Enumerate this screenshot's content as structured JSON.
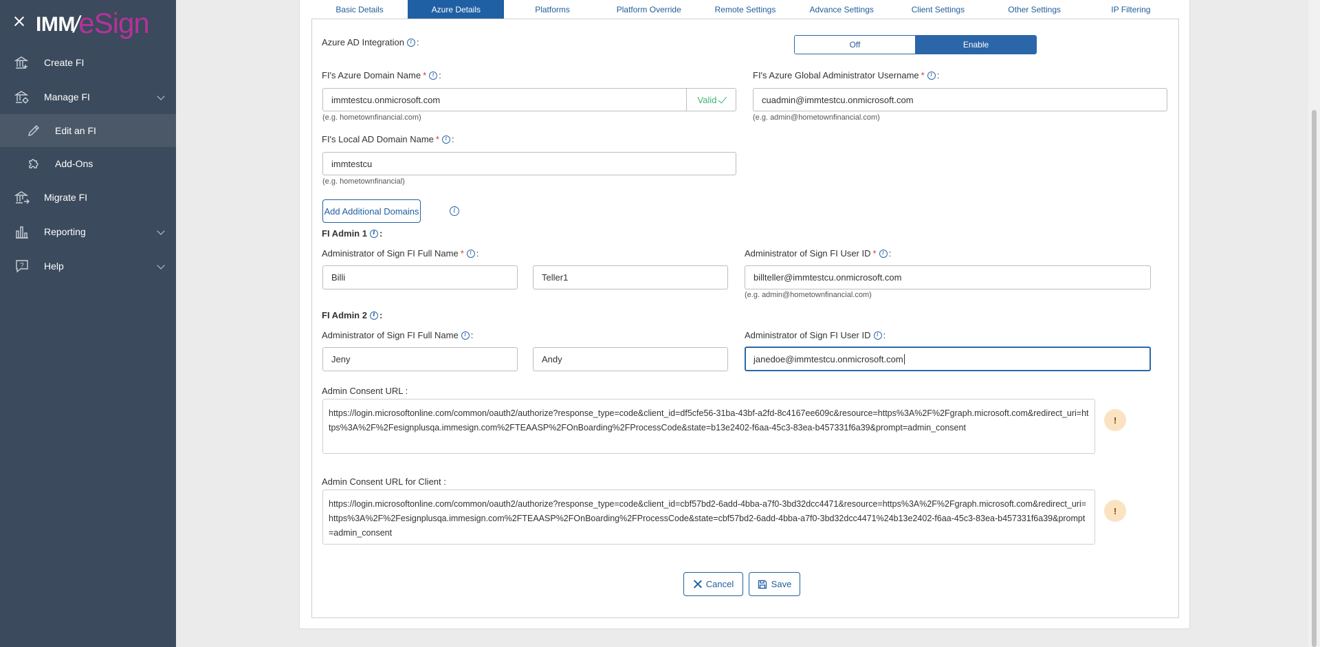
{
  "brand": {
    "imm": "IMM",
    "esign": "eSign",
    "accent": "#b5329b",
    "sidebar_bg": "#3b4a5c",
    "primary": "#1f5fa3"
  },
  "sidebar": {
    "items": [
      {
        "label": "Create FI",
        "icon": "bank-plus-icon"
      },
      {
        "label": "Manage FI",
        "icon": "bank-gear-icon",
        "expandable": true
      },
      {
        "label": "Edit an FI",
        "icon": "pencil-icon",
        "sub": true,
        "active": true
      },
      {
        "label": "Add-Ons",
        "icon": "puzzle-icon",
        "sub": true
      },
      {
        "label": "Migrate FI",
        "icon": "bank-arrow-icon"
      },
      {
        "label": "Reporting",
        "icon": "bar-chart-icon",
        "expandable": true
      },
      {
        "label": "Help",
        "icon": "help-chat-icon",
        "expandable": true
      }
    ]
  },
  "tabs": [
    {
      "label": "Basic Details",
      "active": false
    },
    {
      "label": "Azure Details",
      "active": true
    },
    {
      "label": "Platforms",
      "active": false
    },
    {
      "label": "Platform Override",
      "active": false
    },
    {
      "label": "Remote Settings",
      "active": false
    },
    {
      "label": "Advance Settings",
      "active": false
    },
    {
      "label": "Client Settings",
      "active": false
    },
    {
      "label": "Other Settings",
      "active": false
    },
    {
      "label": "IP Filtering",
      "active": false
    }
  ],
  "form": {
    "azure_ad": {
      "label": "Azure AD Integration",
      "colon": ":",
      "off": "Off",
      "on": "Enable",
      "value": "Enable"
    },
    "azure_domain": {
      "label": "FI's Azure Domain Name",
      "value": "immtestcu.onmicrosoft.com",
      "valid": "Valid",
      "hint": "(e.g. hometownfinancial.com)"
    },
    "global_admin": {
      "label": "FI's Azure Global Administrator Username",
      "value": "cuadmin@immtestcu.onmicrosoft.com",
      "hint": "(e.g. admin@hometownfinancial.com)"
    },
    "local_domain": {
      "label": "FI's Local AD Domain Name",
      "value": "immtestcu",
      "hint": "(e.g. hometownfinancial)"
    },
    "add_domains_label": "Add Additional Domains",
    "admin1": {
      "heading": "FI Admin 1",
      "name_label": "Administrator of Sign FI Full Name",
      "first": "Billi",
      "last": "Teller1",
      "id_label": "Administrator of Sign FI User ID",
      "user_id": "billteller@immtestcu.onmicrosoft.com",
      "hint": "(e.g. admin@hometownfinancial.com)"
    },
    "admin2": {
      "heading": "FI Admin 2",
      "name_label": "Administrator of Sign FI Full Name",
      "first": "Jeny",
      "last": "Andy",
      "id_label": "Administrator of Sign FI User ID",
      "user_id": "janedoe@immtestcu.onmicrosoft.com"
    },
    "consent_url": {
      "label": "Admin Consent URL :",
      "value": "https://login.microsoftonline.com/common/oauth2/authorize?response_type=code&client_id=df5cfe56-31ba-43bf-a2fd-8c4167ee609c&resource=https%3A%2F%2Fgraph.microsoft.com&redirect_uri=https%3A%2F%2Fesignplusqa.immesign.com%2FTEAASP%2FOnBoarding%2FProcessCode&state=b13e2402-f6aa-45c3-83ea-b457331f6a39&prompt=admin_consent"
    },
    "consent_url_client": {
      "label": "Admin Consent URL for Client :",
      "value": "https://login.microsoftonline.com/common/oauth2/authorize?response_type=code&client_id=cbf57bd2-6add-4bba-a7f0-3bd32dcc4471&resource=https%3A%2F%2Fgraph.microsoft.com&redirect_uri=https%3A%2F%2Fesignplusqa.immesign.com%2FTEAASP%2FOnBoarding%2FProcessCode&state=cbf57bd2-6add-4bba-a7f0-3bd32dcc4471%24b13e2402-f6aa-45c3-83ea-b457331f6a39&prompt=admin_consent"
    },
    "warn_glyph": "!",
    "colon": ":",
    "required_mark": "*",
    "info_glyph": "i"
  },
  "actions": {
    "cancel": "Cancel",
    "save": "Save"
  }
}
